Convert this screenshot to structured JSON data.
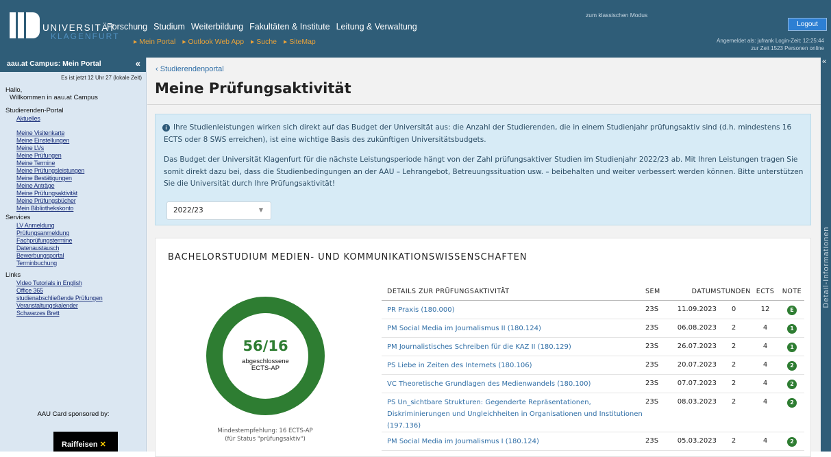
{
  "header": {
    "uni_name": "UNIVERSITÄT",
    "uni_city": "KLAGENFURT",
    "main_nav": [
      "Forschung",
      "Studium",
      "Weiterbildung",
      "Fakultäten & Institute",
      "Leitung & Verwaltung"
    ],
    "sub_nav": [
      "Mein Portal",
      "Outlook Web App",
      "Suche",
      "SiteMap"
    ],
    "classic_mode": "zum klassischen Modus",
    "logout": "Logout",
    "user_line1": "Angemeldet als: jufrank  Login-Zeit: 12:25:44",
    "user_line2": "zur Zeit  1523  Personen online"
  },
  "sidebar": {
    "title": "aau.at Campus: Mein Portal",
    "collapse_icon": "«",
    "time": "Es ist jetzt 12 Uhr 27 (lokale Zeit)",
    "greeting": "Hallo,",
    "welcome": "Willkommen in aau.at Campus",
    "sections": [
      {
        "title": "Studierenden-Portal",
        "links": [
          "Aktuelles",
          "Meine Visitenkarte",
          "Meine Einstellungen",
          "Meine LVs",
          "Meine Prüfungen",
          "Meine Termine",
          "Meine Prüfungsleistungen",
          "Meine Bestätigungen",
          "Meine Anträge",
          "Meine Prüfungsaktivität",
          "Meine Prüfungsbücher",
          "Mein Bibliothekskonto"
        ]
      },
      {
        "title": "Services",
        "links": [
          "LV Anmeldung",
          "Prüfungsanmeldung",
          "Fachprüfungstermine",
          "Datenaustausch",
          "Bewerbungsportal",
          "Terminbuchung"
        ]
      },
      {
        "title": "Links",
        "links": [
          "Video Tutorials in English",
          "Office 365",
          "studienabschließende Prüfungen",
          "Veranstaltungskalender",
          "Schwarzes Brett"
        ]
      }
    ],
    "card_sponsor": "AAU Card sponsored by:",
    "sponsor_logo_text": "Raiffeisen"
  },
  "main": {
    "back_link": "Studierendenportal",
    "title": "Meine Prüfungsaktivität",
    "info_p1": "Ihre Studienleistungen wirken sich direkt auf das Budget der Universität aus: die Anzahl der Studierenden, die in einem Studienjahr prüfungsaktiv sind (d.h. mindestens 16 ECTS oder 8 SWS erreichen), ist eine wichtige Basis des zukünftigen Universitätsbudgets.",
    "info_p2": "Das Budget der Universität Klagenfurt für die nächste Leistungsperiode hängt von der Zahl prüfungsaktiver Studien im Studienjahr 2022/23 ab. Mit Ihren Leistungen tragen Sie somit direkt dazu bei, dass die Studienbedingungen an der AAU – Lehrangebot, Betreuungssituation usw. – beibehalten und weiter verbessert werden können. Bitte unterstützen Sie die Universität durch Ihre Prüfungsaktivität!",
    "year_selected": "2022/23",
    "study": {
      "title": "BACHELORSTUDIUM MEDIEN- UND KOMMUNIKATIONSWISSENSCHAFTEN",
      "donut_value": "56/16",
      "donut_label": "abgeschlossene ECTS-AP",
      "min_rec_1": "Mindestempfehlung: 16 ECTS-AP",
      "min_rec_2": "(für Status \"prüfungsaktiv\")",
      "columns": {
        "details": "DETAILS ZUR PRÜFUNGSAKTIVITÄT",
        "sem": "SEM",
        "date": "DATUM",
        "hours": "STUNDEN",
        "ects": "ECTS",
        "grade": "NOTE"
      },
      "rows": [
        {
          "name": "PR Praxis (180.000)",
          "sem": "23S",
          "date": "11.09.2023",
          "hours": "0",
          "ects": "12",
          "grade": "E"
        },
        {
          "name": "PM Social Media im Journalismus II (180.124)",
          "sem": "23S",
          "date": "06.08.2023",
          "hours": "2",
          "ects": "4",
          "grade": "1"
        },
        {
          "name": "PM Journalistisches Schreiben für die KAZ II (180.129)",
          "sem": "23S",
          "date": "26.07.2023",
          "hours": "2",
          "ects": "4",
          "grade": "1"
        },
        {
          "name": "PS Liebe in Zeiten des Internets (180.106)",
          "sem": "23S",
          "date": "20.07.2023",
          "hours": "2",
          "ects": "4",
          "grade": "2"
        },
        {
          "name": "VC Theoretische Grundlagen des Medienwandels (180.100)",
          "sem": "23S",
          "date": "07.07.2023",
          "hours": "2",
          "ects": "4",
          "grade": "2"
        },
        {
          "name": "PS Un_sichtbare Strukturen: Gegenderte Repräsentationen, Diskriminierungen und Ungleichheiten in Organisationen und Institutionen (197.136)",
          "sem": "23S",
          "date": "08.03.2023",
          "hours": "2",
          "ects": "4",
          "grade": "2"
        },
        {
          "name": "PM Social Media im Journalismus I (180.124)",
          "sem": "23S",
          "date": "05.03.2023",
          "hours": "2",
          "ects": "4",
          "grade": "2"
        }
      ]
    }
  },
  "right_rail": {
    "label": "Detail-Informationen",
    "collapse_icon": "«"
  },
  "colors": {
    "header": "#2f5d78",
    "accent_orange": "#e8a23a",
    "grade_green": "#2e7d32",
    "info_bg": "#d7ebf6"
  }
}
